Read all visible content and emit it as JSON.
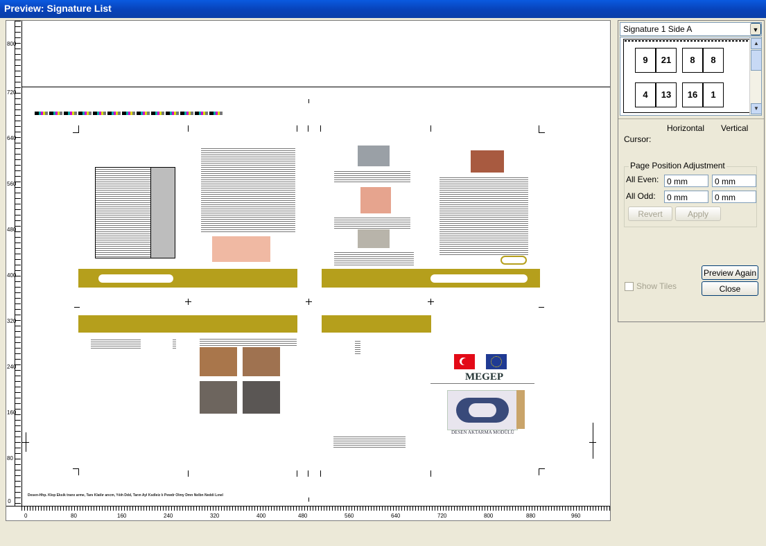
{
  "window": {
    "title": "Preview: Signature List"
  },
  "signature_select": {
    "value": "Signature 1 Side A"
  },
  "thumbnail": {
    "top_row": [
      "9",
      "21",
      "8",
      "8"
    ],
    "bottom_row": [
      "4",
      "13",
      "16",
      "1"
    ]
  },
  "panel": {
    "cursor_label": "Cursor:",
    "horizontal_label": "Horizontal",
    "vertical_label": "Vertical",
    "group_label": "Page Position Adjustment",
    "all_even_label": "All Even:",
    "all_odd_label": "All Odd:",
    "even_h": "0 mm",
    "even_v": "0 mm",
    "odd_h": "0 mm",
    "odd_v": "0 mm",
    "revert": "Revert",
    "apply": "Apply",
    "show_tiles": "Show Tiles",
    "preview_again": "Preview Again",
    "close": "Close"
  },
  "rulers": {
    "horizontal": [
      "0",
      "80",
      "160",
      "240",
      "320",
      "400",
      "480",
      "560",
      "640",
      "720",
      "800",
      "880",
      "960"
    ],
    "vertical": [
      "800",
      "720",
      "640",
      "560",
      "480",
      "400",
      "320",
      "240",
      "160",
      "80",
      "0"
    ]
  },
  "sheet": {
    "megep_title": "MEGEP",
    "module_title": "DESEN AKTARMA MODÜLÜ",
    "footer_credit": "Desen-Hhp. Klop Eksik tranx arme, Tanı Klatlır arıcm, Yılıh Ddd, Tarın Ayl Ksdleiz lı Pewdr Olmy Dmn Nelbn Neddi Lınel"
  }
}
